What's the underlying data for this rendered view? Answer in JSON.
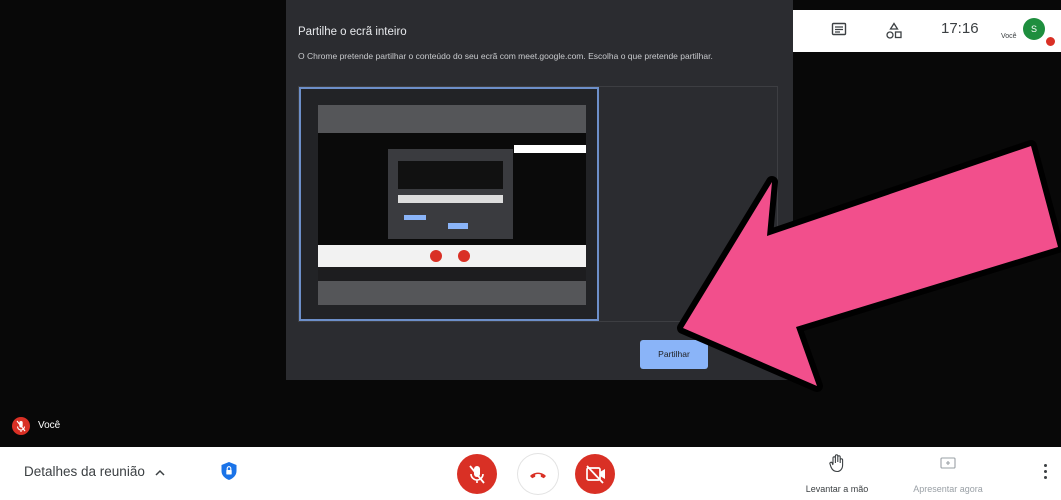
{
  "dialog": {
    "title": "Partilhe o ecrã inteiro",
    "description": "O Chrome pretende partilhar o conteúdo do seu ecrã com meet.google.com. Escolha o que pretende partilhar.",
    "share_button": "Partilhar"
  },
  "top_panel": {
    "chat_icon": "chat-icon",
    "activities_icon": "activities-icon",
    "time": "17:16",
    "you_label": "Você",
    "avatar_initial": "S"
  },
  "self_tile": {
    "name": "Você"
  },
  "bottom_bar": {
    "details_label": "Detalhes da reunião",
    "raise_hand_label": "Levantar a mão",
    "present_label": "Apresentar agora"
  },
  "colors": {
    "accent_blue": "#8ab4f8",
    "alert_red": "#d93025",
    "arrow_pink": "#f24f8c",
    "avatar_green": "#1e8e3e"
  }
}
